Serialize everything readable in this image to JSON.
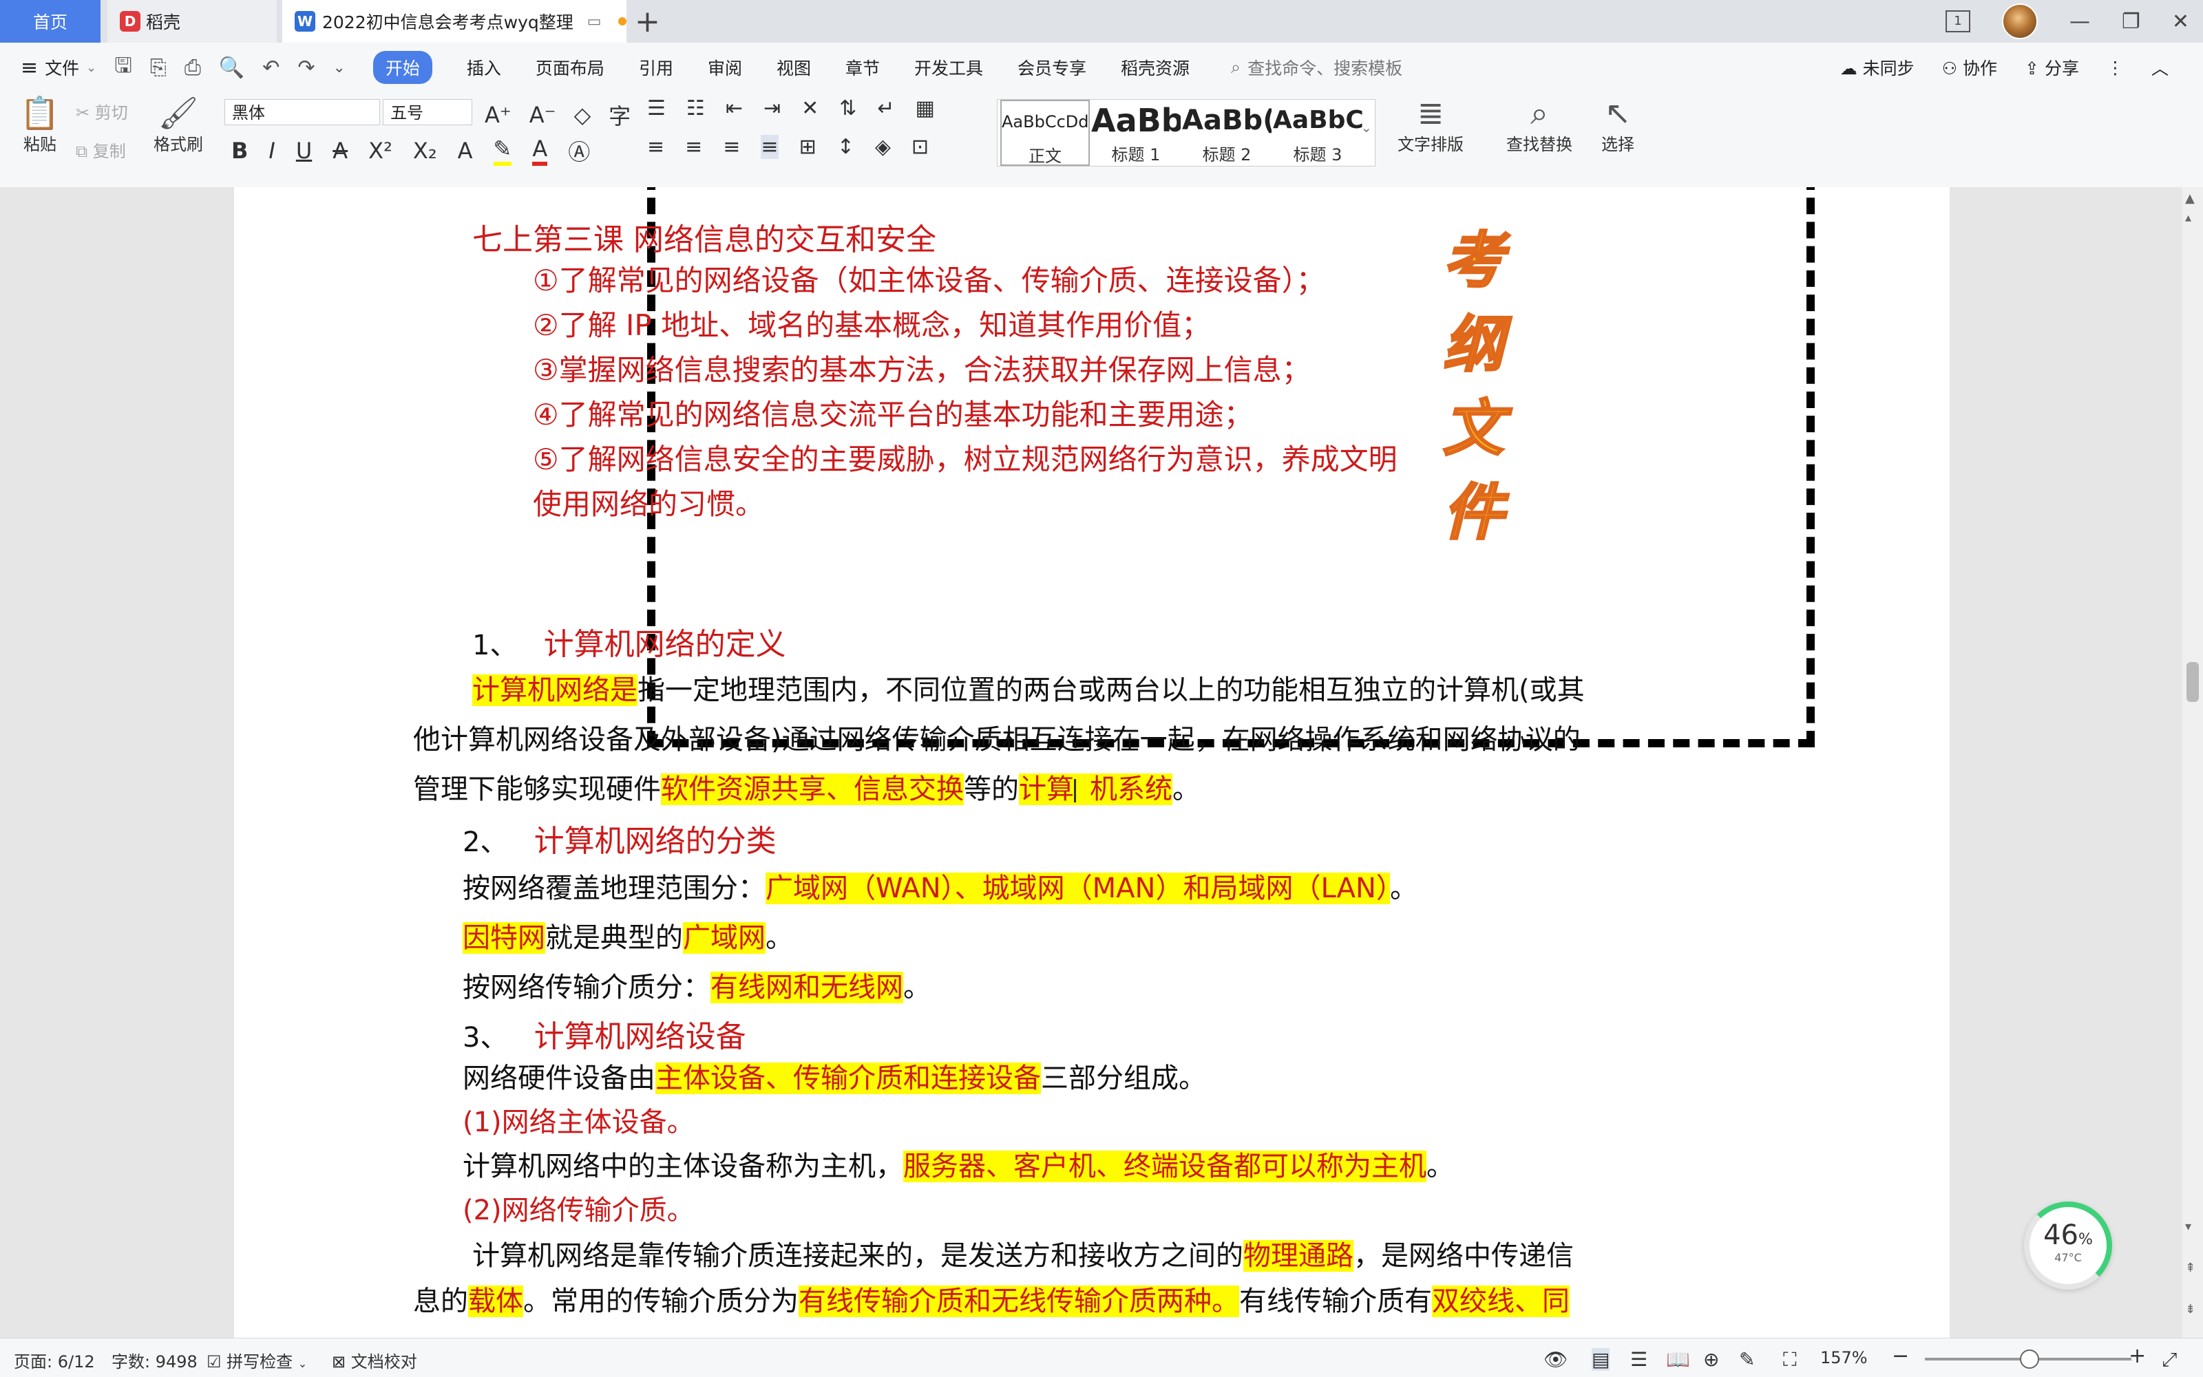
{
  "tabs": {
    "home": "首页",
    "daoke": "稻壳",
    "doc": "2022初中信息会考考点wyq整理",
    "new_tab": "+"
  },
  "window": {
    "page_badge": "1",
    "min": "—",
    "max": "❐",
    "close": "✕"
  },
  "menu": {
    "file": "文件",
    "items": [
      "开始",
      "插入",
      "页面布局",
      "引用",
      "审阅",
      "视图",
      "章节",
      "开发工具",
      "会员专享",
      "稻壳资源"
    ],
    "search_placeholder": "查找命令、搜索模板",
    "sync": "未同步",
    "collab": "协作",
    "share": "分享"
  },
  "ribbon": {
    "paste": "粘贴",
    "cut": "剪切",
    "copy": "复制",
    "format_painter": "格式刷",
    "font_name": "黑体",
    "font_size": "五号",
    "styles": [
      {
        "sample": "AaBbCcDd",
        "name": "正文"
      },
      {
        "sample": "AaBb",
        "name": "标题 1"
      },
      {
        "sample": "AaBb(",
        "name": "标题 2"
      },
      {
        "sample": "AaBbC",
        "name": "标题 3"
      }
    ],
    "text_layout": "文字排版",
    "find_replace": "查找替换",
    "select": "选择"
  },
  "outline": {
    "title": "七上第三课  网络信息的交互和安全",
    "items": [
      "①了解常见的网络设备（如主体设备、传输介质、连接设备）；",
      "②了解 IP 地址、域名的基本概念，知道其作用价值；",
      "③掌握网络信息搜索的基本方法，合法获取并保存网上信息；",
      "④了解常见的网络信息交流平台的基本功能和主要用途；",
      "⑤了解网络信息安全的主要威胁，树立规范网络行为意识，养成文明",
      "使用网络的习惯。"
    ],
    "stamp": "考纲文件"
  },
  "body": {
    "s1_num": "1、",
    "s1_title": "计算机网络的定义",
    "p1_hl": "计算机网络是",
    "p1_a": "指一定地理范围内，不同位置的两台或两台以上的功能相互独立的计算机(或其",
    "p1_b": "他计算机网络设备及外部设备)通过网络传输介质相互连接在一起，在网络操作系统和网络协议的",
    "p1_c": "管理下能够实现硬件",
    "p1_hl2": "软件资源共享、信息交换",
    "p1_d": "等的",
    "p1_hl3a": "计算",
    "p1_hl3b": "机系统",
    "p1_e": "。",
    "s2_num": "2、",
    "s2_title": "计算机网络的分类",
    "p2_a": "按网络覆盖地理范围分：",
    "p2_hl": "广域网（WAN）、城域网（MAN）和局域网（LAN）",
    "p2_end": "。",
    "p3_hl": "因特网",
    "p3_a": "就是典型的",
    "p3_hl2": "广域网",
    "p3_end": "。",
    "p4_a": "按网络传输介质分：",
    "p4_hl": "有线网和无线网",
    "p4_end": "。",
    "s3_num": "3、",
    "s3_title": "计算机网络设备",
    "p5_a": "网络硬件设备由",
    "p5_hl": "主体设备、传输介质和连接设备",
    "p5_b": "三部分组成。",
    "sub1": "(1)网络主体设备。",
    "p6_a": "计算机网络中的主体设备称为主机，",
    "p6_hl": "服务器、客户机、终端设备都可以称为主机",
    "p6_end": "。",
    "sub2": "(2)网络传输介质。",
    "p7_a": "计算机网络是靠传输介质连接起来的，是发送方和接收方之间的",
    "p7_hl": "物理通路",
    "p7_b": "，是网络中传递信",
    "p8_a": "息的",
    "p8_hl": "载体",
    "p8_b": "。常用的传输介质分为",
    "p8_hl2": "有线传输介质和无线传输介质两种。",
    "p8_c": "有线传输介质有",
    "p8_hl3": "双绞线、同"
  },
  "perf": {
    "percent": "46",
    "unit": "%",
    "temp": "47°C"
  },
  "status": {
    "page": "页面: 6/12",
    "words": "字数: 9498",
    "spell": "拼写检查",
    "proof": "文档校对",
    "zoom": "157%"
  },
  "colors": {
    "accent": "#4a7ee8",
    "heading_red": "#cc1b1b",
    "highlight": "#fffb00"
  }
}
